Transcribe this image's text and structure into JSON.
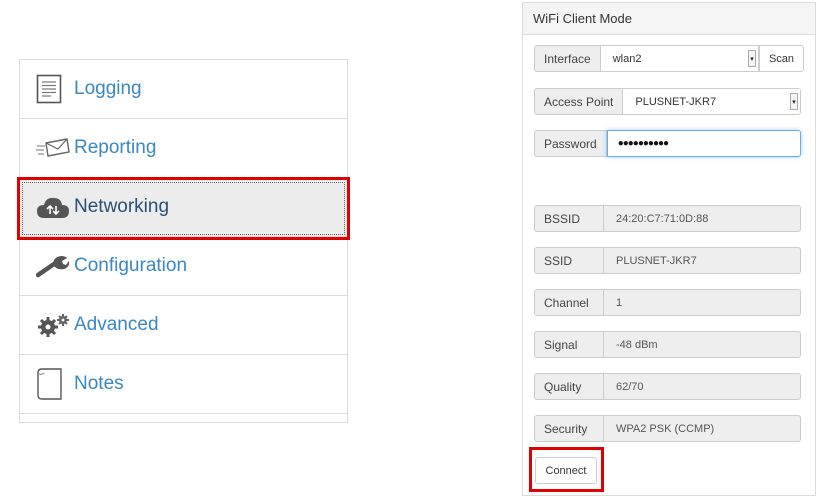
{
  "nav": {
    "items": [
      {
        "label": "Logging",
        "icon": "document-lines-icon"
      },
      {
        "label": "Reporting",
        "icon": "envelope-send-icon"
      },
      {
        "label": "Networking",
        "icon": "cloud-sync-icon",
        "active": true
      },
      {
        "label": "Configuration",
        "icon": "wrench-icon"
      },
      {
        "label": "Advanced",
        "icon": "gears-icon"
      },
      {
        "label": "Notes",
        "icon": "page-icon"
      }
    ]
  },
  "wifi": {
    "title": "WiFi Client Mode",
    "interface_label": "Interface",
    "interface_value": "wlan2",
    "scan_label": "Scan",
    "access_point_label": "Access Point",
    "access_point_value": "PLUSNET-JKR7",
    "password_label": "Password",
    "password_value": "●●●●●●●●●●",
    "info": [
      {
        "label": "BSSID",
        "value": "24:20:C7:71:0D:88"
      },
      {
        "label": "SSID",
        "value": "PLUSNET-JKR7"
      },
      {
        "label": "Channel",
        "value": "1"
      },
      {
        "label": "Signal",
        "value": "-48 dBm"
      },
      {
        "label": "Quality",
        "value": "62/70"
      },
      {
        "label": "Security",
        "value": "WPA2 PSK (CCMP)"
      }
    ],
    "connect_label": "Connect"
  },
  "colors": {
    "highlight": "#e00000",
    "link": "#3a87c4"
  }
}
